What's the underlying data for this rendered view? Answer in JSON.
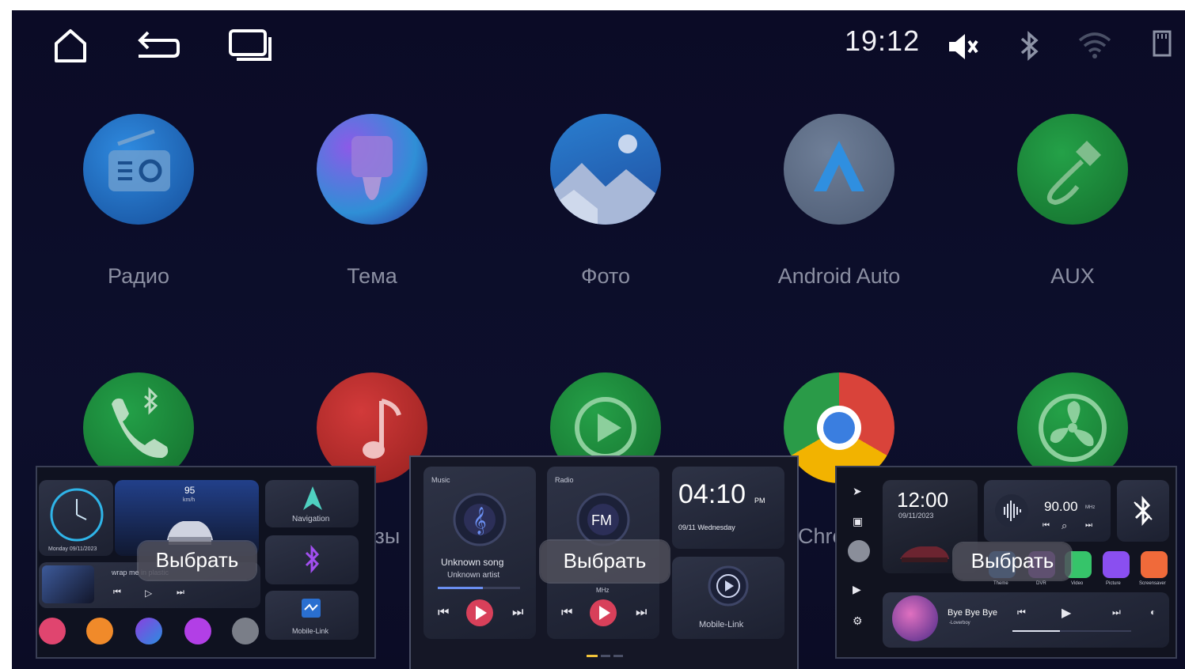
{
  "statusbar": {
    "time": "19:12",
    "icons": [
      "home-icon",
      "back-icon",
      "recents-icon",
      "mute-icon",
      "bluetooth-icon",
      "wifi-icon",
      "sd-card-icon"
    ]
  },
  "apps": [
    {
      "label": "Радио",
      "icon": "radio-icon",
      "color": "#1f78c8"
    },
    {
      "label": "Тема",
      "icon": "theme-brush-icon",
      "color": "#6b3fd6"
    },
    {
      "label": "Фото",
      "icon": "photo-icon",
      "color": "#2a7fd0"
    },
    {
      "label": "Android Auto",
      "icon": "android-auto-icon",
      "color": "#5f6f86"
    },
    {
      "label": "AUX",
      "icon": "aux-cable-icon",
      "color": "#1d8f3a"
    },
    {
      "label": "",
      "icon": "bt-phone-icon",
      "color": "#1c8c3a"
    },
    {
      "label": "узы",
      "icon": "bt-music-icon",
      "color": "#c02f2f"
    },
    {
      "label": "",
      "icon": "video-play-icon",
      "color": "#1d8f3a"
    },
    {
      "label": "Chrc",
      "icon": "chrome-icon",
      "color": "#2f6fd0"
    },
    {
      "label": "",
      "icon": "fan-icon",
      "color": "#1d8f3a"
    }
  ],
  "select_label": "Выбрать",
  "card1": {
    "date": "Monday 09/11/2023",
    "speed": "95",
    "speed_unit": "km/h",
    "nav_label": "Navigation",
    "song": "wrap me in plastic",
    "mobile_link": "Mobile-Link"
  },
  "card2": {
    "music_tag": "Music",
    "radio_tag": "Radio",
    "song": "Unknown song",
    "artist": "Unknown artist",
    "fm_label": "FM",
    "mhz": "MHz",
    "time": "04:10",
    "ampm": "PM",
    "date": "09/11 Wednesday",
    "mobile_link": "Mobile-Link"
  },
  "card3": {
    "time": "12:00",
    "date": "09/11/2023",
    "freq": "90.00",
    "freq_unit": "MHz",
    "song": "Bye Bye Bye",
    "artist": "-Loverboy",
    "app_labels": [
      "Theme",
      "DVR",
      "Video",
      "Picture",
      "Screensaver"
    ]
  }
}
